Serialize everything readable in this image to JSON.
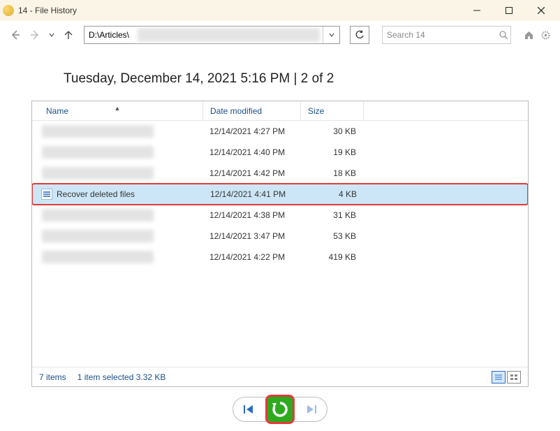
{
  "window": {
    "title": "14 - File History"
  },
  "nav": {
    "address_value": "D:\\Articles\\",
    "search_placeholder": "Search 14"
  },
  "headline": "Tuesday, December 14, 2021 5:16 PM   |   2 of 2",
  "columns": {
    "name": "Name",
    "date": "Date modified",
    "size": "Size"
  },
  "files": [
    {
      "name": "",
      "blur": true,
      "date": "12/14/2021 4:27 PM",
      "size": "30 KB",
      "selected": false
    },
    {
      "name": "",
      "blur": true,
      "date": "12/14/2021 4:40 PM",
      "size": "19 KB",
      "selected": false
    },
    {
      "name": "",
      "blur": true,
      "date": "12/14/2021 4:42 PM",
      "size": "18 KB",
      "selected": false
    },
    {
      "name": "Recover deleted files",
      "blur": false,
      "date": "12/14/2021 4:41 PM",
      "size": "4 KB",
      "selected": true
    },
    {
      "name": "",
      "blur": true,
      "date": "12/14/2021 4:38 PM",
      "size": "31 KB",
      "selected": false
    },
    {
      "name": "",
      "blur": true,
      "date": "12/14/2021 3:47 PM",
      "size": "53 KB",
      "selected": false
    },
    {
      "name": "",
      "blur": true,
      "date": "12/14/2021 4:22 PM",
      "size": "419 KB",
      "selected": false
    }
  ],
  "status": {
    "items": "7 items",
    "selected": "1 item selected  3.32 KB"
  }
}
